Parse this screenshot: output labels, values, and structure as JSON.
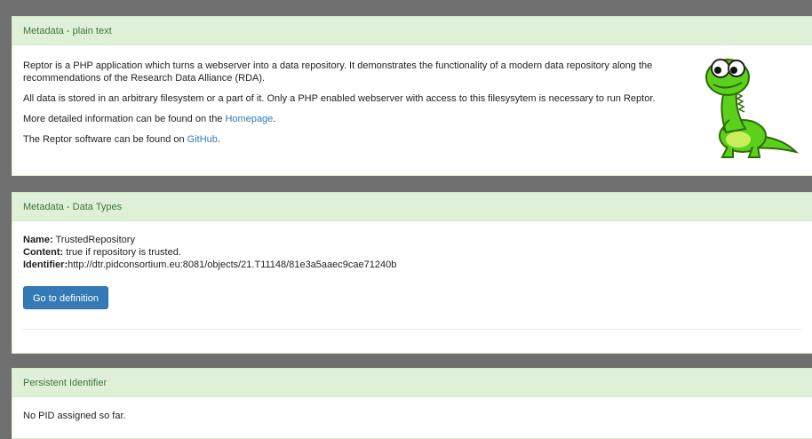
{
  "panel1": {
    "heading": "Metadata - plain text",
    "p1": "Reptor is a PHP application which turns a webserver into a data repository. It demonstrates the functionality of a modern data repository along the recommendations of the Research Data Alliance (RDA).",
    "p2": "All data is stored in an arbitrary filesystem or a part of it. Only a PHP enabled webserver with access to this filesysytem is necessary to run Reptor.",
    "p3_prefix": "More detailed information can be found on the ",
    "p3_link": "Homepage",
    "p3_suffix": ".",
    "p4_prefix": "The Reptor software can be found on ",
    "p4_link": "GitHub",
    "p4_suffix": "."
  },
  "panel2": {
    "heading": "Metadata - Data Types",
    "name_label": "Name:",
    "name_value": " TrustedRepository",
    "content_label": "Content:",
    "content_value": " true if repository is trusted.",
    "identifier_label": "Identifier:",
    "identifier_value": "http://dtr.pidconsortium.eu:8081/objects/21.T11148/81e3a5aaec9cae71240b",
    "button_label": "Go to definition"
  },
  "panel3": {
    "heading": "Persistent Identifier",
    "text": "No PID assigned so far."
  },
  "colors": {
    "heading_bg": "#dff0d8",
    "heading_text": "#3c763d",
    "link": "#337ab7",
    "button_bg": "#337ab7",
    "backdrop": "#6f6f6f",
    "mascot_green": "#5cd11c"
  },
  "icons": {
    "mascot": "green-dinosaur-mascot"
  }
}
